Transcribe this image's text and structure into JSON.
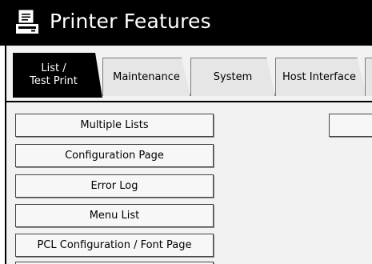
{
  "window": {
    "title": "Printer Features",
    "title_icon": "printer-document-icon"
  },
  "tabs": [
    {
      "label": "List /\nTest Print",
      "active": true
    },
    {
      "label": "Maintenance",
      "active": false
    },
    {
      "label": "System",
      "active": false
    },
    {
      "label": "Host Interface",
      "active": false
    }
  ],
  "buttons": {
    "multiple_lists": "Multiple Lists",
    "configuration_page": "Configuration Page",
    "error_log": "Error Log",
    "menu_list": "Menu List",
    "pcl_config": "PCL Configuration / Font Page"
  },
  "colors": {
    "titlebar": "#000000",
    "tab_active": "#000000",
    "panel": "#f2f2f2"
  }
}
